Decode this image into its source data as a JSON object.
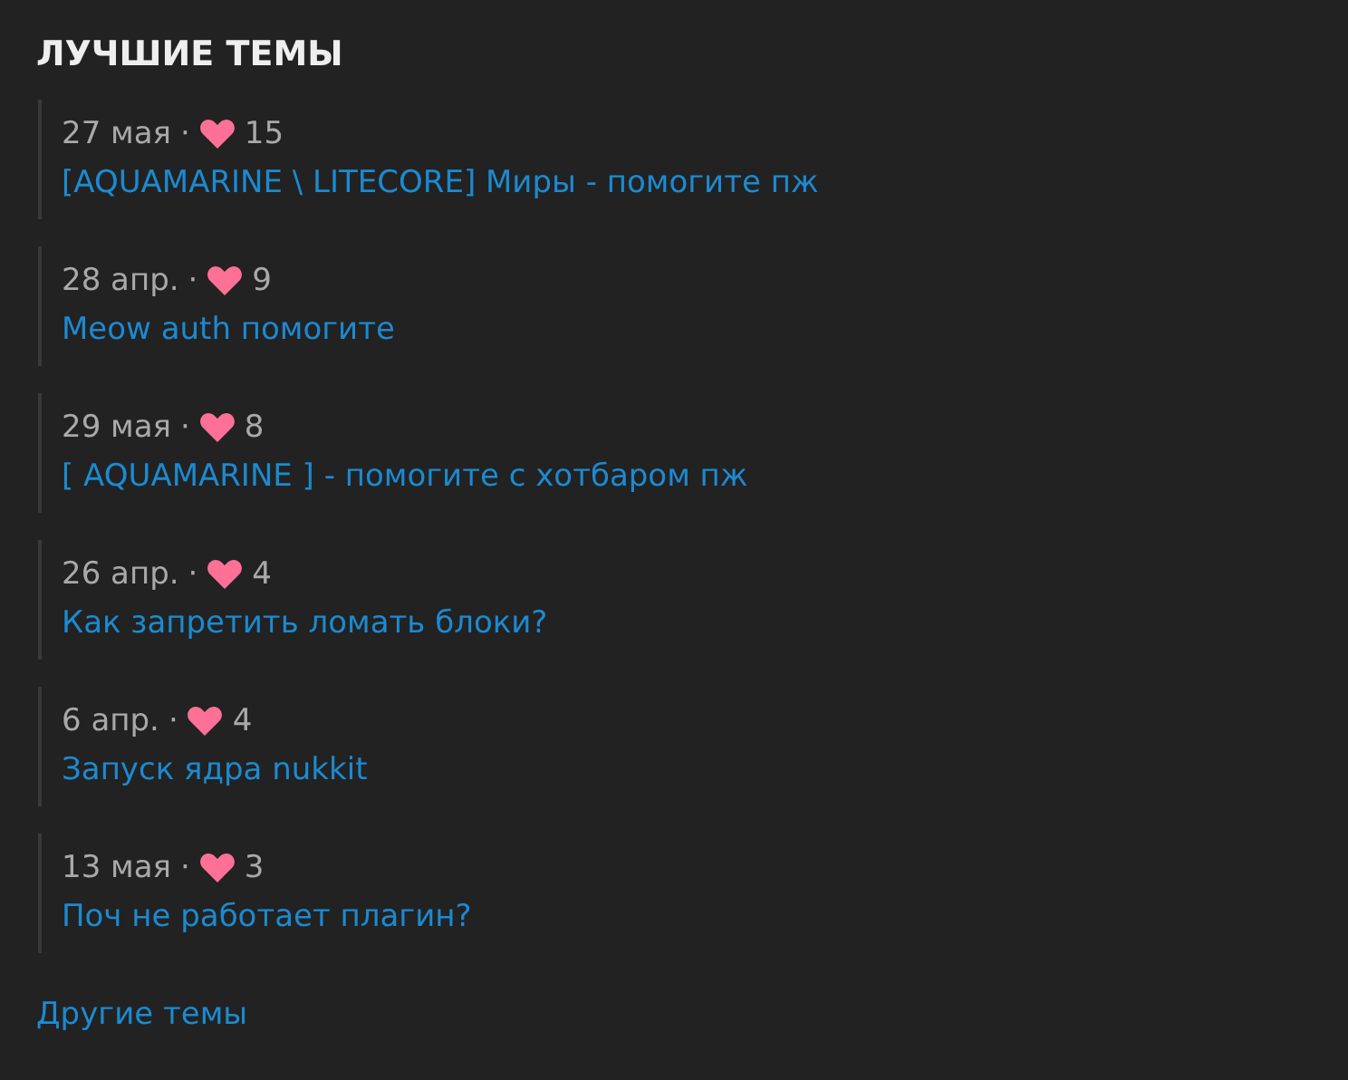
{
  "title": "ЛУЧШИЕ ТЕМЫ",
  "topics": [
    {
      "date": "27 мая",
      "separator": "·",
      "likes": "15",
      "title": "[AQUAMARINE \\ LITECORE] Миры - помогите пж"
    },
    {
      "date": "28 апр.",
      "separator": "·",
      "likes": "9",
      "title": "Meow auth помогите"
    },
    {
      "date": "29 мая",
      "separator": "·",
      "likes": "8",
      "title": "[ AQUAMARINE ] - помогите с хотбаром пж"
    },
    {
      "date": "26 апр.",
      "separator": "·",
      "likes": "4",
      "title": "Как запретить ломать блоки?"
    },
    {
      "date": "6 апр.",
      "separator": "·",
      "likes": "4",
      "title": "Запуск ядра nukkit"
    },
    {
      "date": "13 мая",
      "separator": "·",
      "likes": "3",
      "title": "Поч не работает плагин?"
    }
  ],
  "more_link": "Другие темы"
}
